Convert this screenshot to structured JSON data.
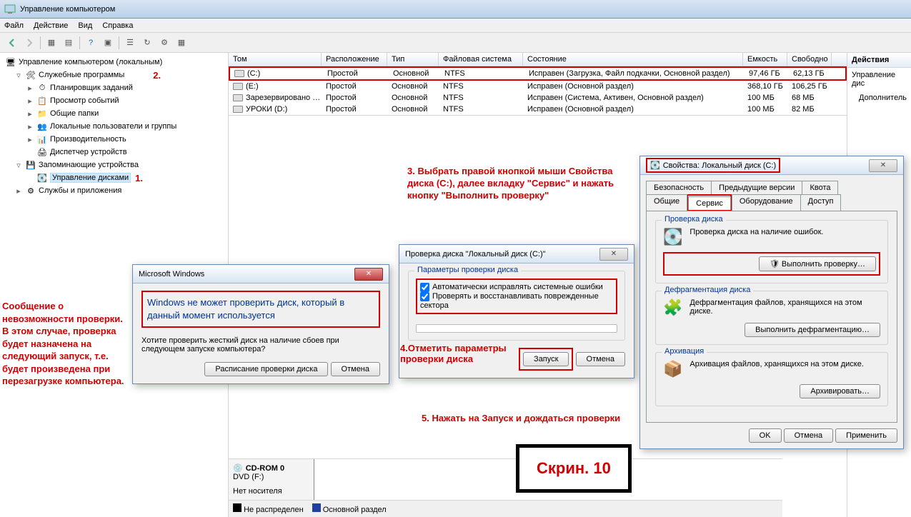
{
  "window": {
    "title": "Управление компьютером"
  },
  "menu": {
    "file": "Файл",
    "action": "Действие",
    "view": "Вид",
    "help": "Справка"
  },
  "tree": {
    "root": "Управление компьютером (локальным)",
    "sys_programs": "Служебные программы",
    "scheduler": "Планировщик заданий",
    "eventviewer": "Просмотр событий",
    "shared": "Общие папки",
    "users": "Локальные пользователи и группы",
    "perf": "Производительность",
    "devmgr": "Диспетчер устройств",
    "storage": "Запоминающие устройства",
    "diskmgmt": "Управление дисками",
    "services": "Службы и приложения"
  },
  "markers": {
    "one": "1.",
    "two": "2."
  },
  "volumes": {
    "headers": {
      "tom": "Том",
      "loc": "Расположение",
      "type": "Тип",
      "fs": "Файловая система",
      "status": "Состояние",
      "cap": "Емкость",
      "free": "Свободно"
    },
    "rows": [
      {
        "tom": "(C:)",
        "loc": "Простой",
        "type": "Основной",
        "fs": "NTFS",
        "status": "Исправен (Загрузка, Файл подкачки, Основной раздел)",
        "cap": "97,46 ГБ",
        "free": "62,13 ГБ"
      },
      {
        "tom": "(E:)",
        "loc": "Простой",
        "type": "Основной",
        "fs": "NTFS",
        "status": "Исправен (Основной раздел)",
        "cap": "368,10 ГБ",
        "free": "106,25 ГБ"
      },
      {
        "tom": "Зарезервировано …",
        "loc": "Простой",
        "type": "Основной",
        "fs": "NTFS",
        "status": "Исправен (Система, Активен, Основной раздел)",
        "cap": "100 МБ",
        "free": "68 МБ"
      },
      {
        "tom": "УРОКИ (D:)",
        "loc": "Простой",
        "type": "Основной",
        "fs": "NTFS",
        "status": "Исправен (Основной раздел)",
        "cap": "100 МБ",
        "free": "82 МБ"
      }
    ]
  },
  "actions": {
    "title": "Действия",
    "row1": "Управление дис",
    "row2": "Дополнитель"
  },
  "disklayout": {
    "cdrom_title": "CD-ROM 0",
    "cdrom_sub": "DVD (F:)",
    "cdrom_status": "Нет носителя",
    "legend_unalloc": "Не распределен",
    "legend_primary": "Основной раздел"
  },
  "annotation3": "3. Выбрать правой кнопкой мыши Свойства диска (C:), далее вкладку \"Сервис\" и нажать кнопку \"Выполнить проверку\"",
  "annotation4": "4.Отметить параметры проверки диска",
  "annotation5": "5. Нажать на Запуск и дождаться проверки",
  "side_annotation": "Сообщение о невозможности проверки. В этом случае, проверка будет назначена на следующий запуск, т.е. будет произведена при перезагрузке компьютера.",
  "skrin": "Скрин. 10",
  "msgbox": {
    "title": "Microsoft Windows",
    "heading": "Windows не может проверить диск, который в данный момент используется",
    "body": "Хотите проверить жесткий диск на наличие сбоев при следующем запуске компьютера?",
    "btn_schedule": "Расписание проверки диска",
    "btn_cancel": "Отмена"
  },
  "chkdsk": {
    "title": "Проверка диска \"Локальный диск (C:)\"",
    "group": "Параметры проверки диска",
    "opt1": "Автоматически исправлять системные ошибки",
    "opt2": "Проверять и восстанавливать поврежденные сектора",
    "btn_start": "Запуск",
    "btn_cancel": "Отмена"
  },
  "props": {
    "title": "Свойства: Локальный диск (C:)",
    "tabs": {
      "security": "Безопасность",
      "prev": "Предыдущие версии",
      "quota": "Квота",
      "general": "Общие",
      "service": "Сервис",
      "hardware": "Оборудование",
      "access": "Доступ"
    },
    "check_group": "Проверка диска",
    "check_text": "Проверка диска на наличие ошибок.",
    "check_btn": "Выполнить проверку…",
    "defrag_group": "Дефрагментация диска",
    "defrag_text": "Дефрагментация файлов, хранящихся на этом диске.",
    "defrag_btn": "Выполнить дефрагментацию…",
    "backup_group": "Архивация",
    "backup_text": "Архивация файлов, хранящихся на этом диске.",
    "backup_btn": "Архивировать…",
    "ok": "OK",
    "cancel": "Отмена",
    "apply": "Применить"
  }
}
